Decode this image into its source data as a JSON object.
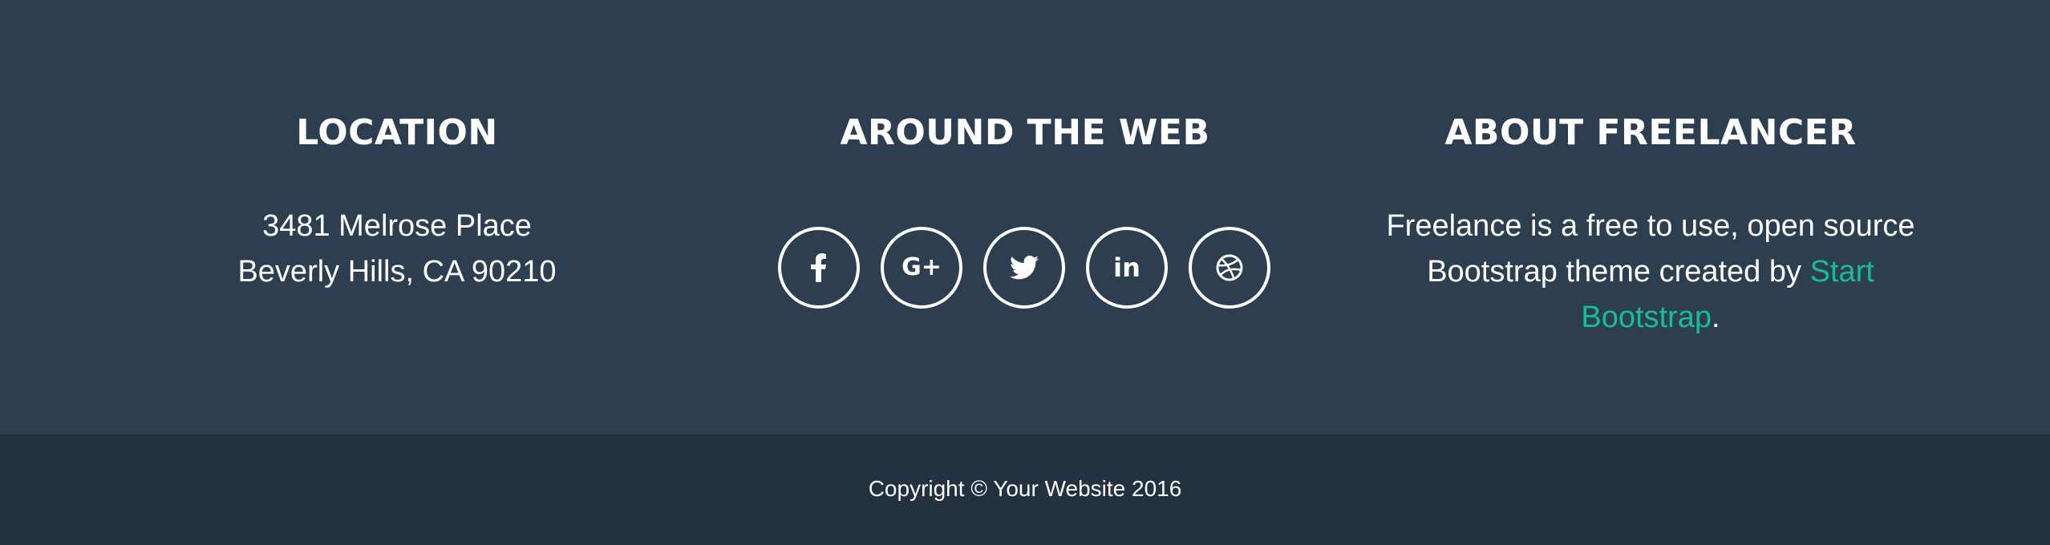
{
  "footer": {
    "location": {
      "title": "Location",
      "address_line1": "3481 Melrose Place",
      "address_line2": "Beverly Hills, CA 90210"
    },
    "social": {
      "title": "Around the Web",
      "links": [
        {
          "icon": "facebook-icon",
          "label": "f"
        },
        {
          "icon": "google-plus-icon",
          "label": "G+"
        },
        {
          "icon": "twitter-icon",
          "label": ""
        },
        {
          "icon": "linkedin-icon",
          "label": "in"
        },
        {
          "icon": "dribbble-icon",
          "label": ""
        }
      ]
    },
    "about": {
      "title": "About Freelancer",
      "text_before": "Freelance is a free to use, open source Bootstrap theme created by ",
      "link_text": "Start Bootstrap",
      "text_after": "."
    }
  },
  "copyright": {
    "text": "Copyright © Your Website 2016"
  },
  "colors": {
    "footer_bg": "#2c3e50",
    "bottom_bg": "#233140",
    "accent": "#18bc9c",
    "text": "#ffffff"
  }
}
